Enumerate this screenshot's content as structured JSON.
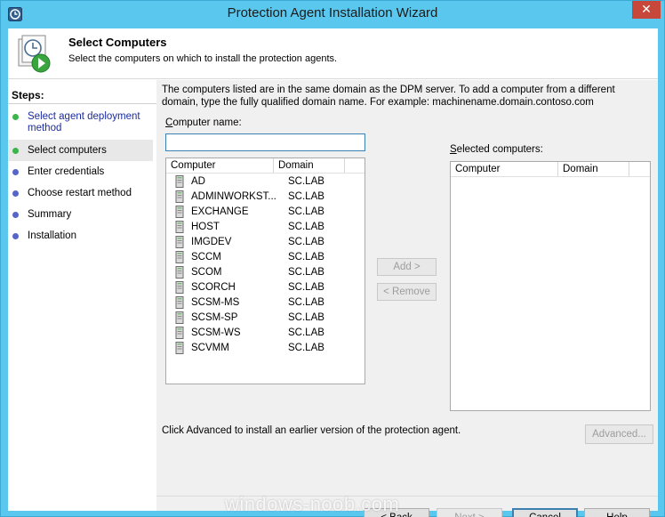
{
  "window": {
    "title": "Protection Agent Installation Wizard",
    "close": "✕"
  },
  "header": {
    "title": "Select Computers",
    "subtitle": "Select the computers on which to install the protection agents."
  },
  "steps": {
    "heading": "Steps:",
    "items": [
      {
        "label": "Select agent deployment method",
        "state": "done",
        "color": "#3bb54a"
      },
      {
        "label": "Select computers",
        "state": "current",
        "color": "#3bb54a"
      },
      {
        "label": "Enter credentials",
        "state": "pending",
        "color": "#5566c8"
      },
      {
        "label": "Choose restart method",
        "state": "pending",
        "color": "#5566c8"
      },
      {
        "label": "Summary",
        "state": "pending",
        "color": "#5566c8"
      },
      {
        "label": "Installation",
        "state": "pending",
        "color": "#5566c8"
      }
    ]
  },
  "main": {
    "info": "The computers listed are in the same domain as the DPM server. To add a computer from a different domain, type the fully qualified domain name. For example: machinename.domain.contoso.com",
    "computer_name_label_u": "C",
    "computer_name_label_rest": "omputer name:",
    "computer_name_value": "",
    "selected_label_u": "S",
    "selected_label_rest": "elected computers:",
    "available": {
      "columns": [
        "Computer",
        "Domain"
      ],
      "rows": [
        {
          "name": "AD",
          "domain": "SC.LAB"
        },
        {
          "name": "ADMINWORKST...",
          "domain": "SC.LAB"
        },
        {
          "name": "EXCHANGE",
          "domain": "SC.LAB"
        },
        {
          "name": "HOST",
          "domain": "SC.LAB"
        },
        {
          "name": "IMGDEV",
          "domain": "SC.LAB"
        },
        {
          "name": "SCCM",
          "domain": "SC.LAB"
        },
        {
          "name": "SCOM",
          "domain": "SC.LAB"
        },
        {
          "name": "SCORCH",
          "domain": "SC.LAB"
        },
        {
          "name": "SCSM-MS",
          "domain": "SC.LAB"
        },
        {
          "name": "SCSM-SP",
          "domain": "SC.LAB"
        },
        {
          "name": "SCSM-WS",
          "domain": "SC.LAB"
        },
        {
          "name": "SCVMM",
          "domain": "SC.LAB"
        }
      ]
    },
    "selected": {
      "columns": [
        "Computer",
        "Domain"
      ]
    },
    "add_button": "Add >",
    "remove_button": "< Remove",
    "advanced_text": "Click Advanced to install an earlier version of the protection agent.",
    "advanced_button": "Advanced..."
  },
  "footer": {
    "back": "< Back",
    "next": "Next >",
    "cancel": "Cancel",
    "help": "Help"
  },
  "watermark": "windows-noob.com"
}
